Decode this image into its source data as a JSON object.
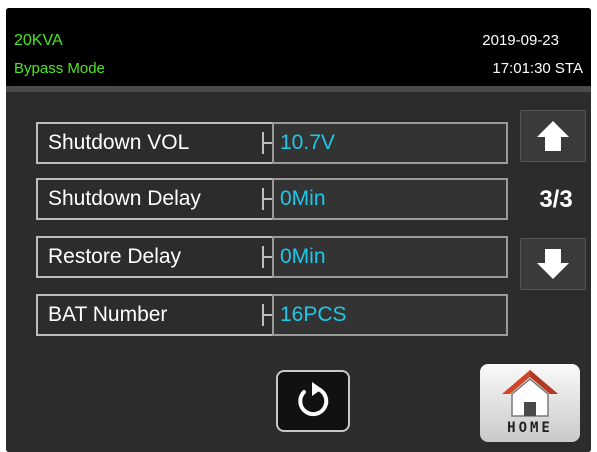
{
  "header": {
    "model": "20KVA",
    "mode": "Bypass Mode",
    "date": "2019-09-23",
    "time": "17:01:30 STA"
  },
  "settings": [
    {
      "label": "Shutdown VOL",
      "value": "10.7V"
    },
    {
      "label": "Shutdown Delay",
      "value": "0Min"
    },
    {
      "label": "Restore Delay",
      "value": "0Min"
    },
    {
      "label": "BAT Number",
      "value": "16PCS"
    }
  ],
  "pager": {
    "page": "3/3",
    "up_icon": "arrow-up-icon",
    "down_icon": "arrow-down-icon"
  },
  "buttons": {
    "refresh_icon": "refresh-icon",
    "home_label": "HOME",
    "home_icon": "house-icon"
  },
  "colors": {
    "status_green": "#4be61e",
    "value_cyan": "#1ec8e8",
    "panel_bg": "#2c2c2c"
  }
}
